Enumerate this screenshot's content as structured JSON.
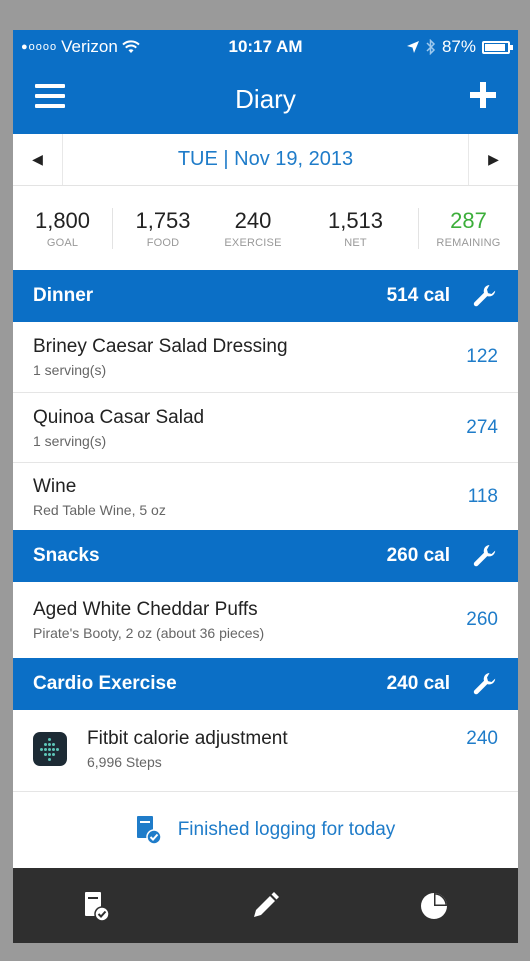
{
  "status_bar": {
    "carrier": "Verizon",
    "signal_dots": "●oooo",
    "time": "10:17 AM",
    "battery": "87%"
  },
  "nav": {
    "title": "Diary"
  },
  "date": {
    "label": "TUE | Nov 19, 2013"
  },
  "summary": [
    {
      "value": "1,800",
      "label": "GOAL"
    },
    {
      "value": "1,753",
      "label": "FOOD"
    },
    {
      "value": "240",
      "label": "EXERCISE"
    },
    {
      "value": "1,513",
      "label": "NET"
    },
    {
      "value": "287",
      "label": "REMAINING"
    }
  ],
  "dinner": {
    "name": "Dinner",
    "cal": "514 cal",
    "items": [
      {
        "title": "Briney Caesar Salad Dressing",
        "sub": "1 serving(s)",
        "value": "122"
      },
      {
        "title": "Quinoa Casar Salad",
        "sub": "1 serving(s)",
        "value": "274"
      },
      {
        "title": "Wine",
        "sub": "Red Table Wine, 5 oz",
        "value": "118"
      }
    ]
  },
  "snacks": {
    "name": "Snacks",
    "cal": "260 cal",
    "items": [
      {
        "title": "Aged White Cheddar Puffs",
        "sub": "Pirate's Booty, 2 oz  (about 36 pieces)",
        "value": "260"
      }
    ]
  },
  "cardio": {
    "name": "Cardio Exercise",
    "cal": "240 cal",
    "items": [
      {
        "title": "Fitbit calorie adjustment",
        "sub": "6,996 Steps",
        "value": "240"
      }
    ]
  },
  "finished": {
    "label": "Finished logging for today"
  },
  "colors": {
    "brand_blue": "#0b6fc6",
    "link_blue": "#1f7cc9",
    "remaining_green": "#3cae3a",
    "tabbar": "#2f2f2f"
  },
  "icons": {
    "menu": "hamburger-icon",
    "add": "plus-icon",
    "prev": "left-arrow-icon",
    "next": "right-arrow-icon",
    "wrench": "wrench-icon",
    "tabs": [
      "diary-check-icon",
      "pencil-icon",
      "pie-chart-icon"
    ]
  }
}
